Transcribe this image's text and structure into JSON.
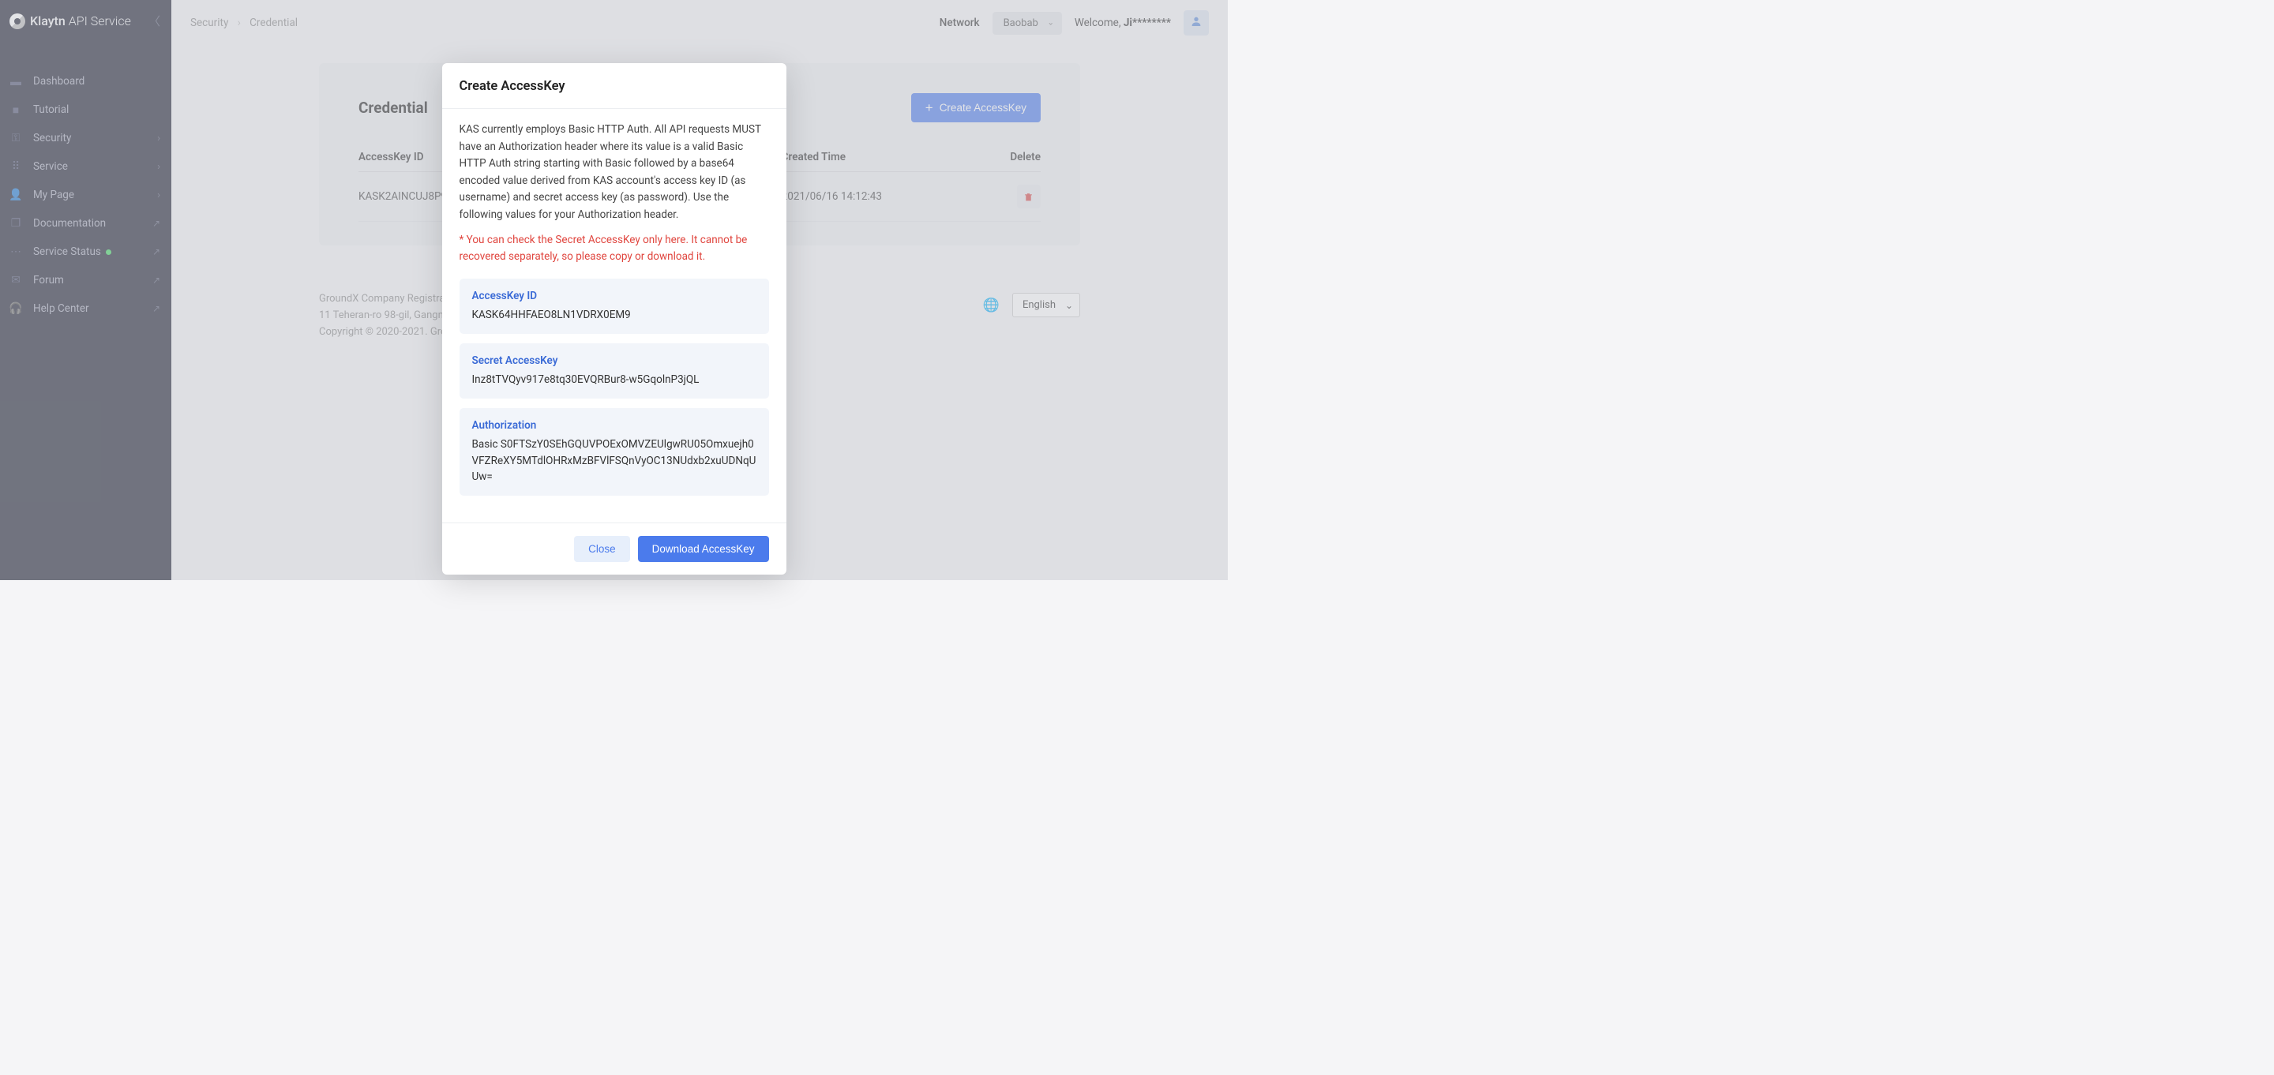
{
  "brand": {
    "name": "Klaytn",
    "suffix": "API Service"
  },
  "sidebar": {
    "items": [
      {
        "label": "Dashboard",
        "icon": "▬",
        "type": "link"
      },
      {
        "label": "Tutorial",
        "icon": "■",
        "type": "link"
      },
      {
        "label": "Security",
        "icon": "⚿",
        "type": "expand"
      },
      {
        "label": "Service",
        "icon": "⠿",
        "type": "expand"
      },
      {
        "label": "My Page",
        "icon": "👤",
        "type": "expand"
      },
      {
        "label": "Documentation",
        "icon": "❐",
        "type": "ext"
      },
      {
        "label": "Service Status",
        "icon": "⋯",
        "type": "ext",
        "status": true
      },
      {
        "label": "Forum",
        "icon": "✉",
        "type": "ext"
      },
      {
        "label": "Help Center",
        "icon": "🎧",
        "type": "ext"
      }
    ]
  },
  "breadcrumb": {
    "a": "Security",
    "b": "Credential"
  },
  "topbar": {
    "network_label": "Network",
    "network_value": "Baobab",
    "welcome_prefix": "Welcome, ",
    "welcome_user": "Ji********"
  },
  "page": {
    "title": "Credential",
    "create_btn": "Create AccessKey",
    "columns": {
      "id": "AccessKey ID",
      "time": "Created Time",
      "del": "Delete"
    },
    "rows": [
      {
        "id": "KASK2AINCUJ8P9…",
        "time": "2021/06/16 14:12:43"
      }
    ]
  },
  "footer": {
    "l1": "GroundX Company Registration N…",
    "l2": "11 Teheran-ro 98-gil, Gangnam-g…",
    "l3": "Copyright © 2020-2021. GroundX…",
    "lang": "English"
  },
  "modal": {
    "title": "Create AccessKey",
    "desc": "KAS currently employs Basic HTTP Auth. All API requests MUST have an Authorization header where its value is a valid Basic HTTP Auth string starting with Basic followed by a base64 encoded value derived from KAS account's access key ID (as username) and secret access key (as password). Use the following values for your Authorization header.",
    "warn": "* You can check the Secret AccessKey only here. It cannot be recovered separately, so please copy or download it.",
    "box1_label": "AccessKey ID",
    "box1_value": "KASK64HHFAEO8LN1VDRX0EM9",
    "box2_label": "Secret AccessKey",
    "box2_value": "Inz8tTVQyv917e8tq30EVQRBur8-w5GqolnP3jQL",
    "box3_label": "Authorization",
    "box3_value": "Basic S0FTSzY0SEhGQUVPOExOMVZEUlgwRU05Omxuejh0VFZReXY5MTdlOHRxMzBFVlFSQnVyOC13NUdxb2xuUDNqUUw=",
    "close": "Close",
    "download": "Download AccessKey"
  }
}
